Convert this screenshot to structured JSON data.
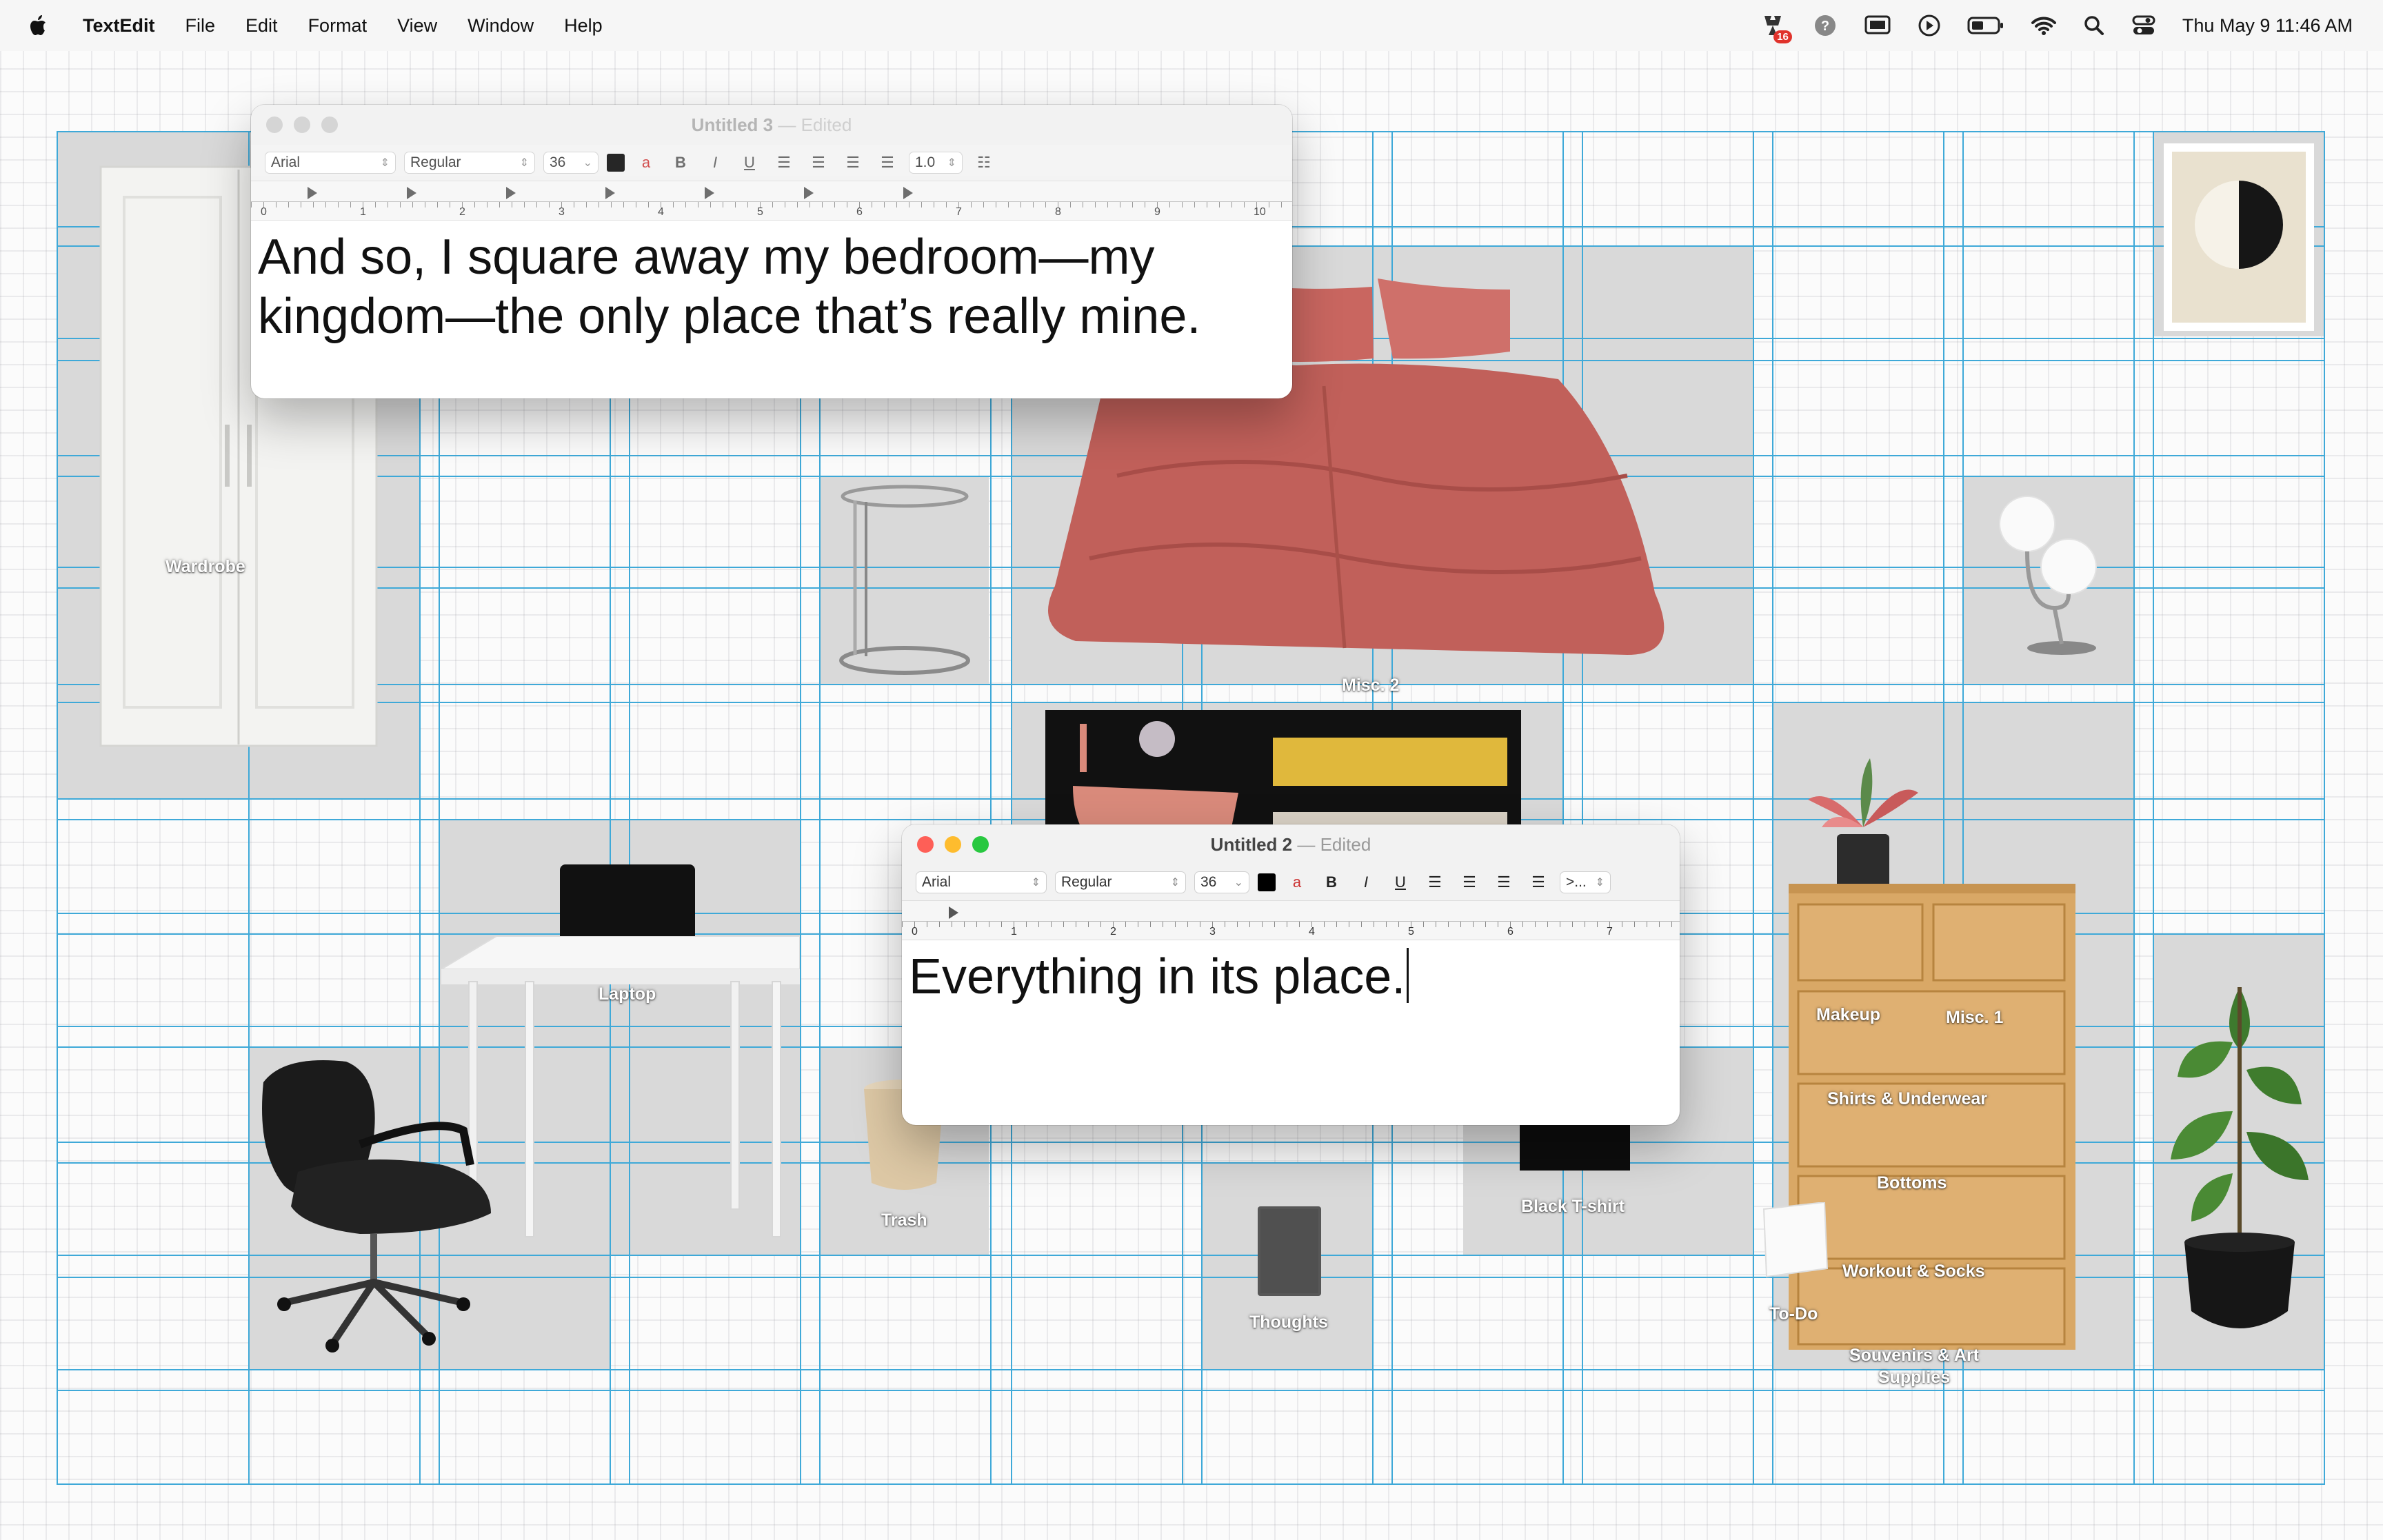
{
  "menubar": {
    "app_name": "TextEdit",
    "menus": [
      "File",
      "Edit",
      "Format",
      "View",
      "Window",
      "Help"
    ],
    "notification_badge": "16",
    "clock": "Thu May 9  11:46 AM"
  },
  "board": {
    "labels": {
      "wardrobe": "Wardrobe",
      "misc2": "Misc. 2",
      "laptop": "Laptop",
      "trash": "Trash",
      "thoughts": "Thoughts",
      "black_tshirt": "Black T-shirt",
      "makeup": "Makeup",
      "misc1": "Misc. 1",
      "shirts": "Shirts & Underwear",
      "bottoms": "Bottoms",
      "workout": "Workout & Socks",
      "todo": "To-Do",
      "souvenirs": "Souvenirs & Art Supplies"
    },
    "colors": {
      "grid_line": "#3fa9d8",
      "cell": "#d9d9d9",
      "bedding": "#c9665f",
      "dresser": "#d9a866"
    }
  },
  "window_back": {
    "title": "Untitled 3",
    "status": "Edited",
    "font": "Arial",
    "style": "Regular",
    "size": "36",
    "spacing": "1.0",
    "ruler_numbers": [
      "0",
      "1",
      "2",
      "3",
      "4",
      "5",
      "6",
      "7",
      "8",
      "9",
      "10"
    ],
    "text": "And so, I square away my bedroom—my kingdom—the only place that’s really mine."
  },
  "window_front": {
    "title": "Untitled 2",
    "status": "Edited",
    "font": "Arial",
    "style": "Regular",
    "size": "36",
    "list_marker": ">...",
    "ruler_numbers": [
      "0",
      "1",
      "2",
      "3",
      "4",
      "5",
      "6",
      "7"
    ],
    "text": "Everything in its place."
  },
  "toolbar_icons": [
    "bold-icon",
    "italic-icon",
    "underline-icon",
    "align-left-icon",
    "align-center-icon",
    "align-right-icon",
    "justify-icon",
    "list-icon"
  ]
}
